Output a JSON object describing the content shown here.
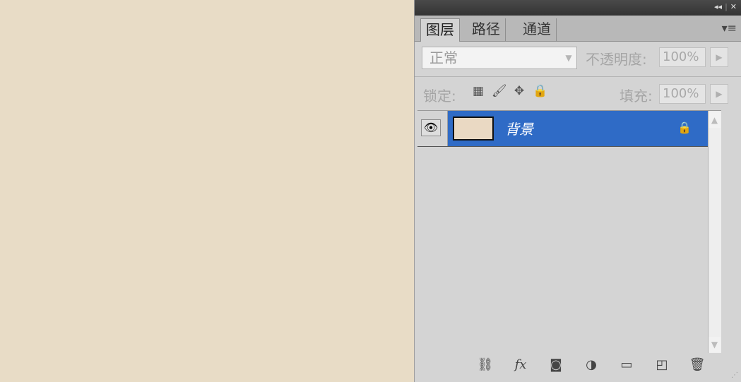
{
  "panel": {
    "tabs": [
      {
        "label": "图层",
        "active": true
      },
      {
        "label": "路径",
        "active": false
      },
      {
        "label": "通道",
        "active": false
      }
    ],
    "blend_mode": "正常",
    "opacity_label": "不透明度:",
    "opacity_value": "100%",
    "lock_label": "锁定:",
    "fill_label": "填充:",
    "fill_value": "100%"
  },
  "layers": [
    {
      "name": "背景",
      "visible": true,
      "locked": true,
      "selected": true,
      "thumb_color": "#ead9c3"
    }
  ],
  "footer_icons": [
    "link-icon",
    "fx-icon",
    "mask-icon",
    "adjustment-icon",
    "folder-icon",
    "new-layer-icon",
    "trash-icon"
  ],
  "colors": {
    "canvas": "#e8dcc6",
    "selection": "#2f6bc6",
    "panel": "#d4d4d4"
  }
}
